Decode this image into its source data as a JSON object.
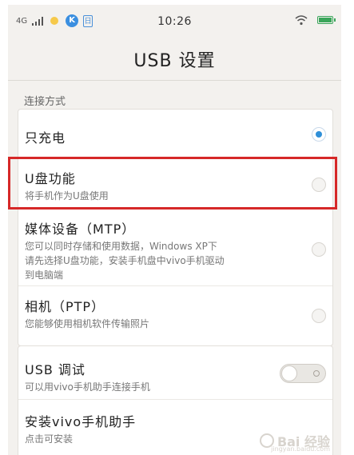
{
  "status_bar": {
    "network": "4G",
    "k_badge": "K",
    "box_badge": "日",
    "time": "10:26",
    "icons": [
      "signal-icon",
      "weather-icon",
      "k-app-icon",
      "notification-icon",
      "wifi-icon",
      "battery-icon"
    ],
    "battery_color": "#3aa55a"
  },
  "header": {
    "title": "USB 设置"
  },
  "connection": {
    "section_label": "连接方式",
    "options": [
      {
        "label": "只充电",
        "sub": "",
        "selected": true
      },
      {
        "label": "U盘功能",
        "sub": "将手机作为U盘使用",
        "selected": false,
        "highlighted": true
      },
      {
        "label": "媒体设备（MTP）",
        "sub_lines": [
          "您可以同时存储和使用数据，Windows XP下",
          "请先选择U盘功能，安装手机盘中vivo手机驱动",
          "到电脑端"
        ],
        "selected": false
      },
      {
        "label": "相机（PTP）",
        "sub": "您能够使用相机软件传输照片",
        "selected": false
      }
    ]
  },
  "tools": {
    "usb_debug": {
      "label": "USB 调试",
      "sub": "可以用vivo手机助手连接手机",
      "enabled": false
    },
    "install": {
      "label": "安装vivo手机助手",
      "sub": "点击可安装"
    }
  },
  "watermark": {
    "text": "Bai 经验",
    "url": "jingyan.baidu.com"
  },
  "colors": {
    "accent": "#2f8fd8",
    "highlight_border": "#d62828",
    "background": "#f3f1ee"
  }
}
